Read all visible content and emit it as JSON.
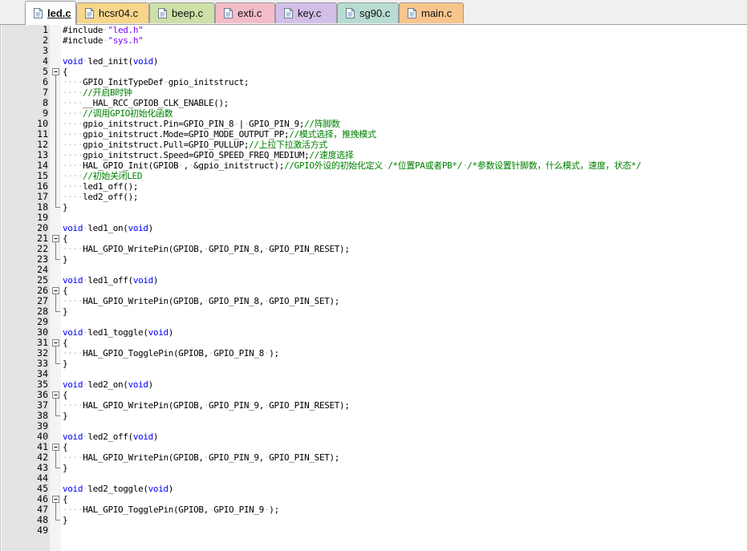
{
  "tabs": [
    {
      "label": "led.c",
      "color": "#ffffff",
      "active": true
    },
    {
      "label": "hcsr04.c",
      "color": "#f7d58a",
      "active": false
    },
    {
      "label": "beep.c",
      "color": "#cde0a8",
      "active": false
    },
    {
      "label": "exti.c",
      "color": "#f3bcc8",
      "active": false
    },
    {
      "label": "key.c",
      "color": "#d2bfe8",
      "active": false
    },
    {
      "label": "sg90.c",
      "color": "#b8dcd2",
      "active": false
    },
    {
      "label": "main.c",
      "color": "#f8c58c",
      "active": false
    }
  ],
  "colors": {
    "keyword": "#0000ff",
    "string": "#8000ff",
    "comment": "#008000",
    "whitespace_dot": "#c0c0c0",
    "gutter": "#e4e4e4"
  },
  "icons": {
    "tab_icon": "document-icon",
    "fold_open": "fold-minus-icon",
    "fold_line": "fold-line-icon"
  },
  "code_lines": [
    {
      "n": "1",
      "fold": "",
      "text": "#include·\"led.h\""
    },
    {
      "n": "2",
      "fold": "",
      "text": "#include·\"sys.h\""
    },
    {
      "n": "3",
      "fold": "",
      "text": ""
    },
    {
      "n": "4",
      "fold": "",
      "text": "void·led_init(void)"
    },
    {
      "n": "5",
      "fold": "open",
      "text": "{"
    },
    {
      "n": "6",
      "fold": "line",
      "text": "····GPIO_InitTypeDef·gpio_initstruct;"
    },
    {
      "n": "7",
      "fold": "line",
      "text": "····//开启B时钟"
    },
    {
      "n": "8",
      "fold": "line",
      "text": "····__HAL_RCC_GPIOB_CLK_ENABLE();"
    },
    {
      "n": "9",
      "fold": "line",
      "text": "····//调用GPIO初始化函数"
    },
    {
      "n": "10",
      "fold": "line",
      "text": "····gpio_initstruct.Pin=GPIO_PIN_8·|·GPIO_PIN_9;//阵脚数"
    },
    {
      "n": "11",
      "fold": "line",
      "text": "····gpio_initstruct.Mode=GPIO_MODE_OUTPUT_PP;//模式选择，推挽模式"
    },
    {
      "n": "12",
      "fold": "line",
      "text": "····gpio_initstruct.Pull=GPIO_PULLUP;//上拉下拉激活方式"
    },
    {
      "n": "13",
      "fold": "line",
      "text": "····gpio_initstruct.Speed=GPIO_SPEED_FREQ_MEDIUM;//速度选择"
    },
    {
      "n": "14",
      "fold": "line",
      "text": "····HAL_GPIO_Init(GPIOB·,·&gpio_initstruct);//GPIO外设的初始化定义·/*位置PA或者PB*/·/*参数设置针脚数，什么模式，速度，状态*/"
    },
    {
      "n": "15",
      "fold": "line",
      "text": "····//初始关闭LED"
    },
    {
      "n": "16",
      "fold": "line",
      "text": "····led1_off();"
    },
    {
      "n": "17",
      "fold": "line",
      "text": "····led2_off();"
    },
    {
      "n": "18",
      "fold": "end",
      "text": "}"
    },
    {
      "n": "19",
      "fold": "",
      "text": ""
    },
    {
      "n": "20",
      "fold": "",
      "text": "void·led1_on(void)"
    },
    {
      "n": "21",
      "fold": "open",
      "text": "{"
    },
    {
      "n": "22",
      "fold": "line",
      "text": "····HAL_GPIO_WritePin(GPIOB,·GPIO_PIN_8,·GPIO_PIN_RESET);"
    },
    {
      "n": "23",
      "fold": "end",
      "text": "}"
    },
    {
      "n": "24",
      "fold": "",
      "text": ""
    },
    {
      "n": "25",
      "fold": "",
      "text": "void·led1_off(void)"
    },
    {
      "n": "26",
      "fold": "open",
      "text": "{"
    },
    {
      "n": "27",
      "fold": "line",
      "text": "····HAL_GPIO_WritePin(GPIOB,·GPIO_PIN_8,·GPIO_PIN_SET);"
    },
    {
      "n": "28",
      "fold": "end",
      "text": "}"
    },
    {
      "n": "29",
      "fold": "",
      "text": ""
    },
    {
      "n": "30",
      "fold": "",
      "text": "void·led1_toggle(void)"
    },
    {
      "n": "31",
      "fold": "open",
      "text": "{"
    },
    {
      "n": "32",
      "fold": "line",
      "text": "····HAL_GPIO_TogglePin(GPIOB,·GPIO_PIN_8·);"
    },
    {
      "n": "33",
      "fold": "end",
      "text": "}"
    },
    {
      "n": "34",
      "fold": "",
      "text": ""
    },
    {
      "n": "35",
      "fold": "",
      "text": "void·led2_on(void)"
    },
    {
      "n": "36",
      "fold": "open",
      "text": "{"
    },
    {
      "n": "37",
      "fold": "line",
      "text": "····HAL_GPIO_WritePin(GPIOB,·GPIO_PIN_9,·GPIO_PIN_RESET);"
    },
    {
      "n": "38",
      "fold": "end",
      "text": "}"
    },
    {
      "n": "39",
      "fold": "",
      "text": ""
    },
    {
      "n": "40",
      "fold": "",
      "text": "void·led2_off(void)"
    },
    {
      "n": "41",
      "fold": "open",
      "text": "{"
    },
    {
      "n": "42",
      "fold": "line",
      "text": "····HAL_GPIO_WritePin(GPIOB,·GPIO_PIN_9,·GPIO_PIN_SET);"
    },
    {
      "n": "43",
      "fold": "end",
      "text": "}"
    },
    {
      "n": "44",
      "fold": "",
      "text": ""
    },
    {
      "n": "45",
      "fold": "",
      "text": "void·led2_toggle(void)"
    },
    {
      "n": "46",
      "fold": "open",
      "text": "{"
    },
    {
      "n": "47",
      "fold": "line",
      "text": "····HAL_GPIO_TogglePin(GPIOB,·GPIO_PIN_9·);"
    },
    {
      "n": "48",
      "fold": "end",
      "text": "}"
    },
    {
      "n": "49",
      "fold": "",
      "text": ""
    }
  ]
}
